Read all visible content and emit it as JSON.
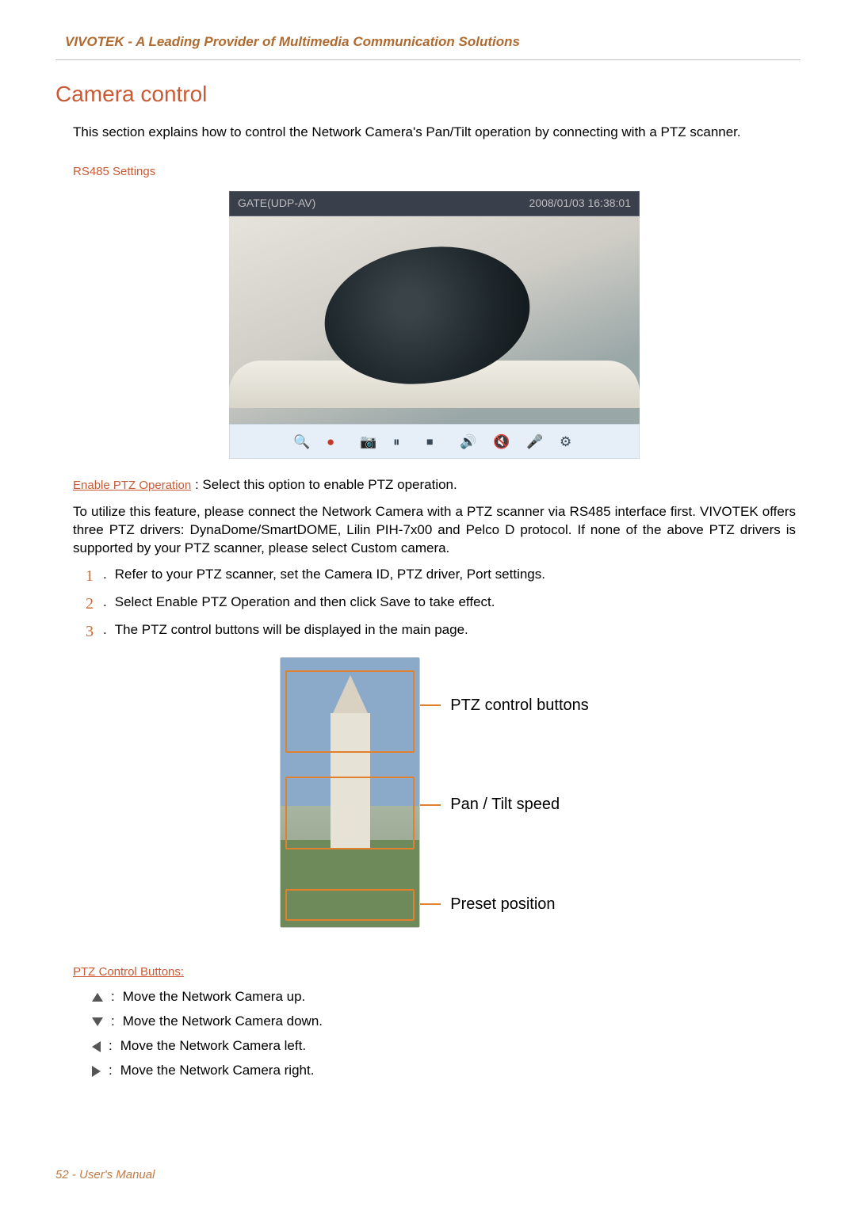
{
  "header": {
    "brand": "VIVOTEK - A Leading Provider of Multimedia Communication Solutions"
  },
  "section_title": "Camera control",
  "intro": "This section explains how to control the Network Camera's Pan/Tilt operation by connecting with a PTZ scanner.",
  "sub_rs485": "RS485 Settings",
  "snap": {
    "label": "GATE(UDP-AV)",
    "timestamp": "2008/01/03 16:38:01"
  },
  "enable": {
    "label": "Enable PTZ Operation",
    "desc": ": Select this option to enable PTZ operation.",
    "paragraph": "To utilize this feature, please connect the Network Camera with a PTZ scanner via RS485 interface first. VIVOTEK offers three PTZ drivers: DynaDome/SmartDOME, Lilin PIH-7x00 and Pelco D protocol. If none of the above PTZ drivers is supported by your PTZ scanner, please select Custom camera."
  },
  "steps": [
    "Refer to your PTZ scanner, set the Camera ID, PTZ driver, Port settings.",
    "Select Enable PTZ Operation and then click Save to take effect.",
    "The PTZ control buttons will be displayed in the main page."
  ],
  "annotations": {
    "a1": "PTZ control buttons",
    "a2": "Pan / Tilt speed",
    "a3": "Preset position"
  },
  "ptz_header": "PTZ Control Buttons:",
  "ptz_buttons": [
    "Move the Network Camera up.",
    "Move the Network Camera down.",
    "Move the Network Camera left.",
    "Move the Network Camera right."
  ],
  "footer": {
    "page": "52",
    "label": "User's Manual"
  }
}
